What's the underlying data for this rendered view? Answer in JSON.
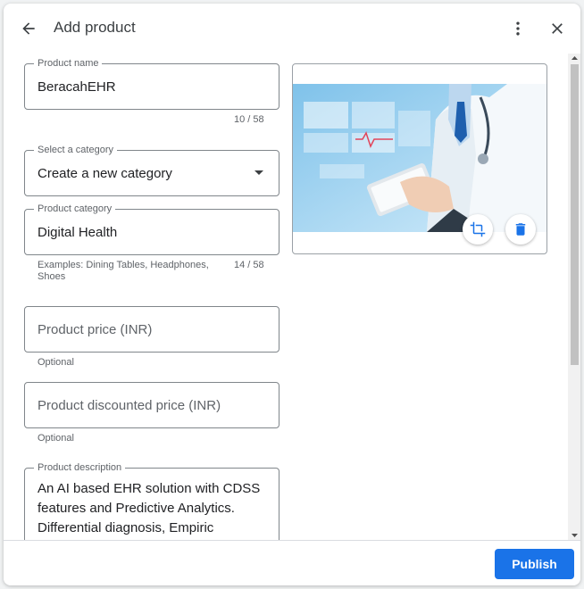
{
  "header": {
    "title": "Add product",
    "back_icon": "arrow-back-icon",
    "more_icon": "more-vert-icon",
    "close_icon": "close-icon"
  },
  "form": {
    "product_name": {
      "label": "Product name",
      "value": "BeracahEHR",
      "counter": "10 / 58"
    },
    "category_select": {
      "label": "Select a category",
      "value": "Create a new category"
    },
    "product_category": {
      "label": "Product category",
      "value": "Digital Health",
      "hint": "Examples: Dining Tables, Headphones, Shoes",
      "counter": "14 / 58"
    },
    "price": {
      "placeholder": "Product price (INR)",
      "hint": "Optional"
    },
    "discounted_price": {
      "placeholder": "Product discounted price (INR)",
      "hint": "Optional"
    },
    "description": {
      "label": "Product description",
      "value": "An AI based EHR solution with CDSS features and Predictive Analytics. Differential diagnosis, Empiric"
    }
  },
  "image": {
    "crop_icon": "crop-icon",
    "delete_icon": "delete-icon"
  },
  "footer": {
    "publish_label": "Publish"
  },
  "colors": {
    "accent": "#1a73e8",
    "image_bg": "#a9d3ee"
  }
}
